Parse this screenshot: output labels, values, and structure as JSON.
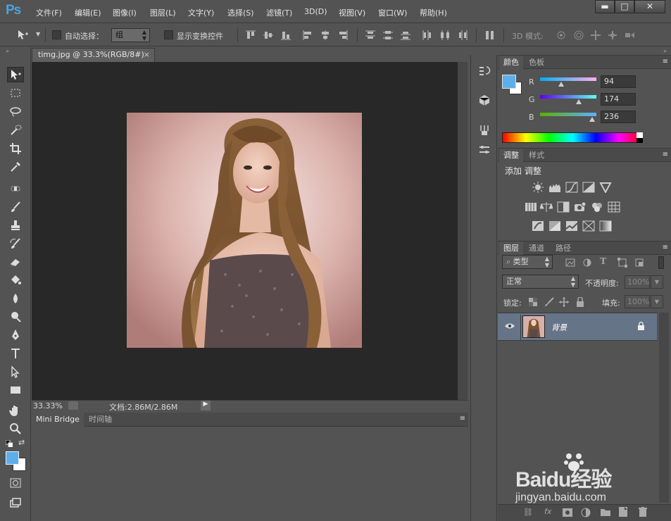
{
  "app": {
    "logo": "Ps"
  },
  "menu": [
    "文件(F)",
    "编辑(E)",
    "图像(I)",
    "图层(L)",
    "文字(Y)",
    "选择(S)",
    "滤镜(T)",
    "3D(D)",
    "视图(V)",
    "窗口(W)",
    "帮助(H)"
  ],
  "window_controls": {
    "minimize": "▬",
    "maximize": "□",
    "close": "✕"
  },
  "options": {
    "auto_select_label": "自动选择：",
    "auto_select_value": "组",
    "show_transform_label": "显示变换控件",
    "mode_3d_label": "3D 模式:"
  },
  "document": {
    "tab_title": "timg.jpg @ 33.3%(RGB/8#)",
    "close": "×"
  },
  "status": {
    "zoom": "33.33%",
    "doc_info": "文档:2.86M/2.86M"
  },
  "bottom_panel": {
    "tabs": [
      "Mini Bridge",
      "时间轴"
    ]
  },
  "color_panel": {
    "tabs": [
      "颜色",
      "色板"
    ],
    "r_label": "R",
    "g_label": "G",
    "b_label": "B",
    "r": 94,
    "g": 174,
    "b": 236,
    "foreground": "#5eaeec",
    "background": "#ffffff"
  },
  "adjust_panel": {
    "tabs": [
      "调整",
      "样式"
    ],
    "title": "添加 调整"
  },
  "layers_panel": {
    "tabs": [
      "图层",
      "通道",
      "路径"
    ],
    "filter": "类型",
    "blend_mode": "正常",
    "opacity_label": "不透明度:",
    "opacity": "100%",
    "lock_label": "锁定:",
    "fill_label": "填充:",
    "fill": "100%",
    "layer_name": "背景"
  },
  "watermark": {
    "brand": "Baidu经验",
    "url": "jingyan.baidu.com"
  },
  "colors": {
    "accent": "#4aa3df",
    "selected_layer": "#667487"
  }
}
